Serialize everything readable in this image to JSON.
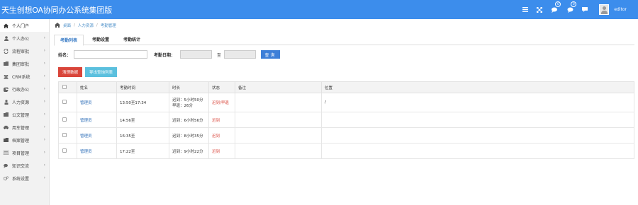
{
  "header": {
    "title": "天生创想OA协同办公系统集团版",
    "icons": [
      "menu-icon",
      "fullscreen-icon",
      "chat-icon",
      "message-icon",
      "comment-icon"
    ],
    "badges": {
      "chat": "0",
      "message": "0"
    },
    "username": "editor"
  },
  "sidebar": {
    "items": [
      {
        "label": "个人门户",
        "icon": "home-icon",
        "active": true
      },
      {
        "label": "个人办公",
        "icon": "user-icon"
      },
      {
        "label": "流程审批",
        "icon": "refresh-icon"
      },
      {
        "label": "集团审批",
        "icon": "folder-icon"
      },
      {
        "label": "CRM系统",
        "icon": "users-icon"
      },
      {
        "label": "行政办公",
        "icon": "chart-icon"
      },
      {
        "label": "人力资源",
        "icon": "person-icon"
      },
      {
        "label": "公文管理",
        "icon": "folder-icon"
      },
      {
        "label": "用车管理",
        "icon": "car-icon"
      },
      {
        "label": "档案管理",
        "icon": "archive-icon"
      },
      {
        "label": "项目管理",
        "icon": "list-icon"
      },
      {
        "label": "知识交流",
        "icon": "chat-icon"
      },
      {
        "label": "系统设置",
        "icon": "gears-icon"
      }
    ]
  },
  "breadcrumb": {
    "home": "桌面",
    "sep": "/",
    "section": "人力资源",
    "page": "考勤管理"
  },
  "tabs": [
    {
      "label": "考勤列表",
      "active": true
    },
    {
      "label": "考勤设置"
    },
    {
      "label": "考勤统计"
    }
  ],
  "search": {
    "name_label": "姓名：",
    "date_label": "考勤日期：",
    "to_label": "至",
    "button": "查询"
  },
  "actions": {
    "clear": "清理数据",
    "export": "导出查询列表"
  },
  "table": {
    "headers": [
      "",
      "姓名",
      "考勤时间",
      "时长",
      "状态",
      "备注",
      "位置"
    ],
    "rows": [
      {
        "name": "管理员",
        "time": "13:50至17:34",
        "duration_line1": "迟到：5小时50分",
        "duration_line2": "早退：26分",
        "status": "迟到/早退",
        "remark": "",
        "location": "/"
      },
      {
        "name": "管理员",
        "time": "14:56至",
        "duration_line1": "迟到：6小时56分",
        "duration_line2": "",
        "status": "迟到",
        "remark": "",
        "location": ""
      },
      {
        "name": "管理员",
        "time": "16:35至",
        "duration_line1": "迟到：8小时35分",
        "duration_line2": "",
        "status": "迟到",
        "remark": "",
        "location": ""
      },
      {
        "name": "管理员",
        "time": "17:22至",
        "duration_line1": "迟到：9小时22分",
        "duration_line2": "",
        "status": "迟到",
        "remark": "",
        "location": ""
      }
    ]
  },
  "colors": {
    "topbar": "#3c8dec",
    "danger": "#d9453a",
    "info": "#5bc0de",
    "primary": "#3d7fd8",
    "link": "#2f6fb8"
  }
}
